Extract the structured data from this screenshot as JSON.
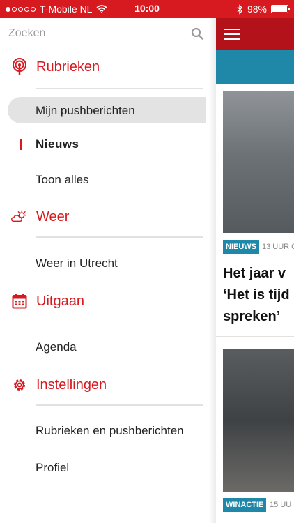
{
  "status": {
    "carrier": "T-Mobile NL",
    "time": "10:00",
    "battery": "98%",
    "battery_level": 0.98
  },
  "search": {
    "placeholder": "Zoeken"
  },
  "sections": {
    "rubrieken": {
      "label": "Rubrieken",
      "items": {
        "selected": "Mijn pushberichten",
        "active": "Nieuws",
        "show_all": "Toon alles"
      }
    },
    "weer": {
      "label": "Weer",
      "items": {
        "city": "Weer in Utrecht"
      }
    },
    "uitgaan": {
      "label": "Uitgaan",
      "items": {
        "agenda": "Agenda"
      }
    },
    "instellingen": {
      "label": "Instellingen",
      "items": {
        "rubrieken_push": "Rubrieken en pushberichten",
        "profiel": "Profiel"
      }
    }
  },
  "feed": {
    "article1": {
      "tag": "NIEUWS",
      "time": "13 UUR G",
      "headline_lines": [
        "Het jaar v",
        "‘Het is tijd",
        "spreken’"
      ]
    },
    "article2": {
      "tag": "WINACTIE",
      "time": "15 UU"
    }
  },
  "colors": {
    "brand_red": "#d71920",
    "teal": "#1f88a8",
    "selected_bg": "#e3e3e3"
  }
}
